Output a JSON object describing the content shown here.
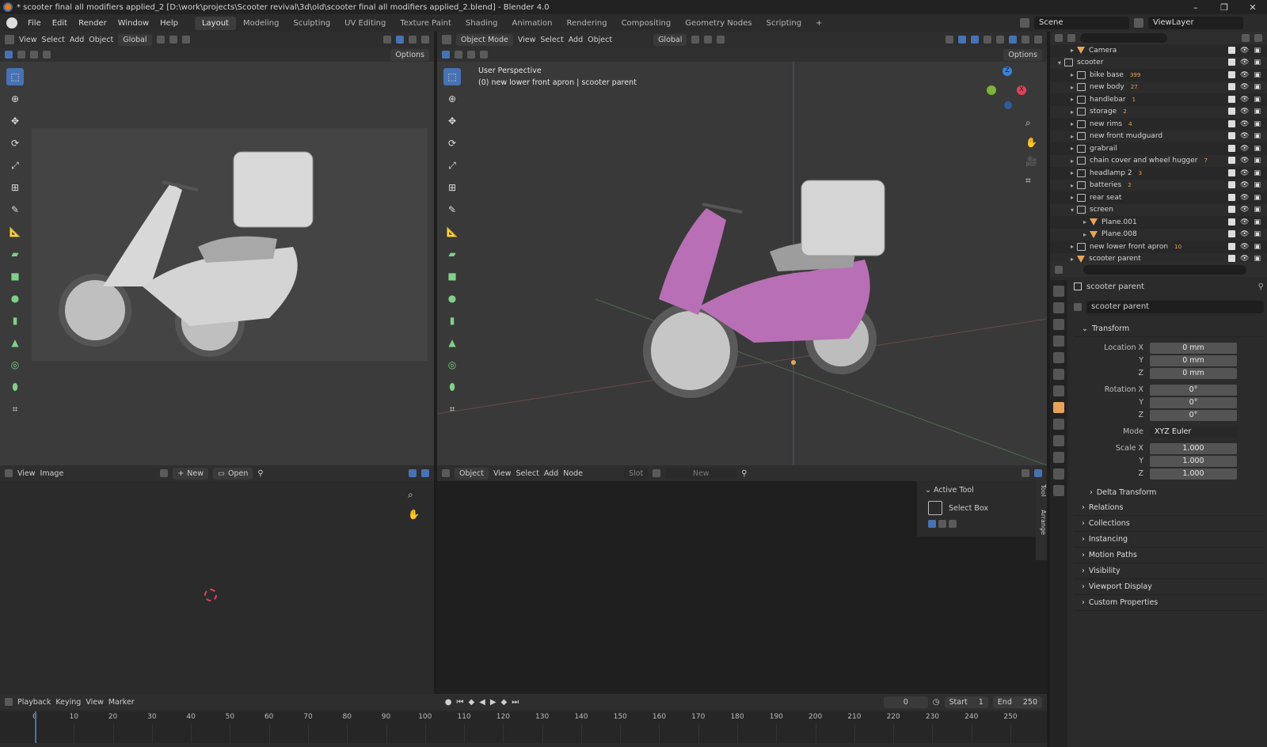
{
  "window": {
    "title": "* scooter final all modifiers applied_2 [D:\\work\\projects\\Scooter revival\\3d\\old\\scooter final all modifiers applied_2.blend] - Blender 4.0"
  },
  "menubar": {
    "menus": [
      "File",
      "Edit",
      "Render",
      "Window",
      "Help"
    ],
    "workspaces": [
      "Layout",
      "Modeling",
      "Sculpting",
      "UV Editing",
      "Texture Paint",
      "Shading",
      "Animation",
      "Rendering",
      "Compositing",
      "Geometry Nodes",
      "Scripting"
    ],
    "active_workspace": "Layout",
    "add_tab": "+",
    "scene": "Scene",
    "view_layer": "ViewLayer"
  },
  "left_viewport": {
    "menus": [
      "View",
      "Select",
      "Add",
      "Object"
    ],
    "orientation": "Global",
    "options": "Options"
  },
  "main_viewport": {
    "mode": "Object Mode",
    "menus": [
      "View",
      "Select",
      "Add",
      "Object"
    ],
    "orientation": "Global",
    "options": "Options",
    "overlay_line1": "User Perspective",
    "overlay_line2": "(0) new lower front apron | scooter parent",
    "gizmo_axes": {
      "z": "Z",
      "y": "Y",
      "x": "X"
    }
  },
  "outliner": {
    "items": [
      {
        "label": "Camera",
        "depth": 1,
        "kind": "object",
        "expanded": false
      },
      {
        "label": "scooter",
        "depth": 0,
        "kind": "collection",
        "expanded": true
      },
      {
        "label": "bike base",
        "depth": 1,
        "kind": "collection",
        "expanded": false,
        "badge": "399"
      },
      {
        "label": "new body",
        "depth": 1,
        "kind": "collection",
        "expanded": false,
        "badge": "27"
      },
      {
        "label": "handlebar",
        "depth": 1,
        "kind": "collection",
        "expanded": false,
        "badge": "1"
      },
      {
        "label": "storage",
        "depth": 1,
        "kind": "collection",
        "expanded": false,
        "badge": "2"
      },
      {
        "label": "new rims",
        "depth": 1,
        "kind": "collection",
        "expanded": false,
        "badge": "4"
      },
      {
        "label": "new front mudguard",
        "depth": 1,
        "kind": "collection",
        "expanded": false
      },
      {
        "label": "grabrail",
        "depth": 1,
        "kind": "collection",
        "expanded": false
      },
      {
        "label": "chain cover and wheel hugger",
        "depth": 1,
        "kind": "collection",
        "expanded": false,
        "badge": "7"
      },
      {
        "label": "headlamp 2",
        "depth": 1,
        "kind": "collection",
        "expanded": false,
        "badge": "3"
      },
      {
        "label": "batteries",
        "depth": 1,
        "kind": "collection",
        "expanded": false,
        "badge": "2"
      },
      {
        "label": "rear seat",
        "depth": 1,
        "kind": "collection",
        "expanded": false
      },
      {
        "label": "screen",
        "depth": 1,
        "kind": "collection",
        "expanded": true
      },
      {
        "label": "Plane.001",
        "depth": 2,
        "kind": "object",
        "expanded": false
      },
      {
        "label": "Plane.008",
        "depth": 2,
        "kind": "object",
        "expanded": false
      },
      {
        "label": "new lower front apron",
        "depth": 1,
        "kind": "collection",
        "expanded": false,
        "badge": "10"
      },
      {
        "label": "scooter parent",
        "depth": 1,
        "kind": "object",
        "expanded": false
      }
    ]
  },
  "properties": {
    "breadcrumb": "scooter parent",
    "object_name": "scooter parent",
    "transform_label": "Transform",
    "location_label": "Location X",
    "rotation_label": "Rotation X",
    "scale_label": "Scale X",
    "axis_y": "Y",
    "axis_z": "Z",
    "location": {
      "x": "0 mm",
      "y": "0 mm",
      "z": "0 mm"
    },
    "rotation": {
      "x": "0°",
      "y": "0°",
      "z": "0°"
    },
    "mode_label": "Mode",
    "mode_value": "XYZ Euler",
    "scale": {
      "x": "1.000",
      "y": "1.000",
      "z": "1.000"
    },
    "delta": "Delta Transform",
    "panels": [
      "Relations",
      "Collections",
      "Instancing",
      "Motion Paths",
      "Visibility",
      "Viewport Display",
      "Custom Properties"
    ]
  },
  "image_editor": {
    "menus": [
      "View",
      "Image"
    ],
    "new_label": "New",
    "open_label": "Open"
  },
  "shader_editor": {
    "mode": "Object",
    "menus": [
      "View",
      "Select",
      "Add",
      "Node"
    ],
    "slot": "Slot",
    "new_label": "New",
    "side_tabs": [
      "Tool",
      "Arrange"
    ],
    "active_tool_title": "Active Tool",
    "active_tool_name": "Select Box"
  },
  "timeline": {
    "menus": [
      "Playback",
      "Keying",
      "View",
      "Marker"
    ],
    "current_frame": "0",
    "start_label": "Start",
    "start": "1",
    "end_label": "End",
    "end": "250",
    "ticks": [
      "0",
      "10",
      "20",
      "30",
      "40",
      "50",
      "60",
      "70",
      "80",
      "90",
      "100",
      "110",
      "120",
      "130",
      "140",
      "150",
      "160",
      "170",
      "180",
      "190",
      "200",
      "210",
      "220",
      "230",
      "240",
      "250"
    ]
  },
  "colors": {
    "accent": "#4772b3",
    "body_paint": "#b86fb5",
    "object_icon": "#e7a35a",
    "mesh_icon": "#7fd08a",
    "playhead": "#4772b3"
  }
}
